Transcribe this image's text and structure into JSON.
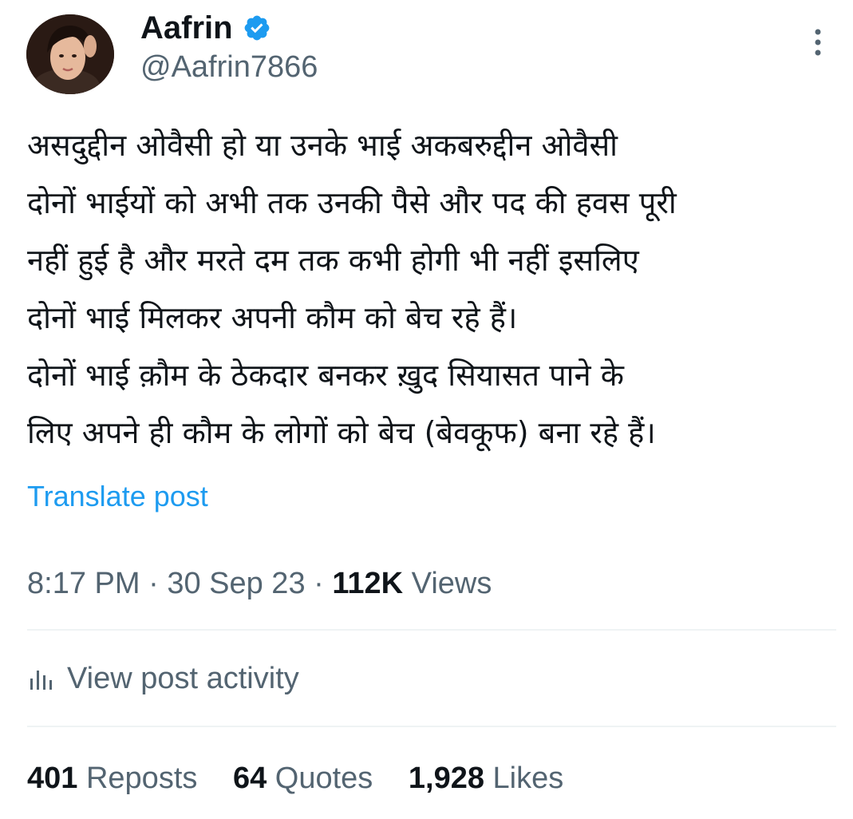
{
  "author": {
    "name": "Aafrin",
    "handle": "@Aafrin7866",
    "verified": true
  },
  "icons": {
    "avatar": "avatar",
    "verified": "verified-badge-icon",
    "more": "more-vertical-icon",
    "activity": "bar-chart-icon"
  },
  "post": {
    "lines": [
      "असदुद्दीन ओवैसी हो या उनके भाई अकबरुद्दीन ओवैसी",
      "दोनों भाईयों को अभी तक उनकी पैसे और पद की हवस पूरी",
      "नहीं हुई है और मरते दम तक कभी होगी भी नहीं इसलिए",
      "दोनों भाई मिलकर अपनी कौम को बेच रहे हैं।",
      "दोनों भाई क़ौम के ठेकदार बनकर ख़ुद सियासत पाने के",
      "लिए अपने ही कौम के लोगों को बेच (बेवकूफ) बना रहे हैं।"
    ],
    "translate_label": "Translate post"
  },
  "meta": {
    "time": "8:17 PM",
    "separator": " · ",
    "date": "30 Sep 23",
    "views_count": "112K",
    "views_label": " Views"
  },
  "activity": {
    "label": "View post activity"
  },
  "stats": [
    {
      "count": "401",
      "label": "Reposts"
    },
    {
      "count": "64",
      "label": "Quotes"
    },
    {
      "count": "1,928",
      "label": "Likes"
    }
  ],
  "colors": {
    "text": "#0f1419",
    "secondary": "#536471",
    "link": "#1d9bf0",
    "divider": "#eff3f4",
    "verified": "#1d9bf0"
  }
}
